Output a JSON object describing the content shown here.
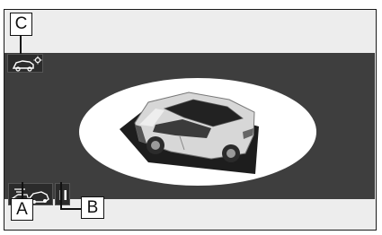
{
  "callouts": {
    "c": "C",
    "a": "A",
    "b": "B"
  },
  "icons": {
    "view_toggle": "car-camera-settings-icon",
    "mode": "car-top-view-toggle-icon",
    "pause": "pause-icon"
  },
  "colors": {
    "screen_background": "#3e3e3e",
    "outer_background": "#ededed",
    "spotlight": "#ffffff",
    "vehicle_body": "#d9d9d9",
    "vehicle_glass": "#1f1f1f"
  }
}
